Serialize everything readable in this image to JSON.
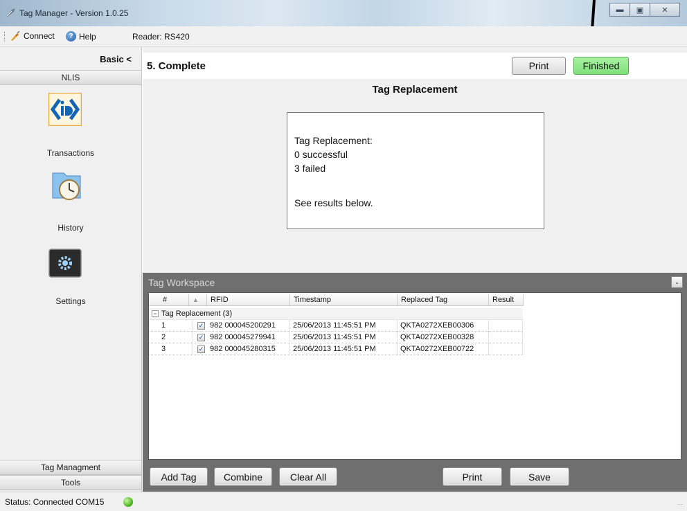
{
  "window": {
    "title": "Tag Manager - Version 1.0.25"
  },
  "menu": {
    "connect": "Connect",
    "help": "Help",
    "reader": "Reader: RS420"
  },
  "sidebar": {
    "mode_toggle": "Basic <",
    "section_top": "NLIS",
    "tiles": [
      {
        "label": "Transactions",
        "icon": "id-logo-icon"
      },
      {
        "label": "History",
        "icon": "clock-folder-icon"
      },
      {
        "label": "Settings",
        "icon": "gear-icon"
      }
    ],
    "section_tag_management": "Tag Managment",
    "section_tools": "Tools"
  },
  "step": {
    "title": "5. Complete",
    "print_label": "Print",
    "finished_label": "Finished"
  },
  "result": {
    "heading": "Tag Replacement",
    "lines": [
      "Tag Replacement:",
      "0 successful",
      "3 failed"
    ],
    "footer": "See results below."
  },
  "workspace": {
    "title": "Tag Workspace",
    "collapse_label": "-",
    "columns": [
      "#",
      "▲",
      "RFID",
      "Timestamp",
      "Replaced Tag",
      "Result"
    ],
    "group_label": "Tag Replacement (3)",
    "rows": [
      {
        "num": "1",
        "rfid": "982 000045200291",
        "timestamp": "25/06/2013 11:45:51 PM",
        "replaced": "QKTA0272XEB00306",
        "result": ""
      },
      {
        "num": "2",
        "rfid": "982 000045279941",
        "timestamp": "25/06/2013 11:45:51 PM",
        "replaced": "QKTA0272XEB00328",
        "result": ""
      },
      {
        "num": "3",
        "rfid": "982 000045280315",
        "timestamp": "25/06/2013 11:45:51 PM",
        "replaced": "QKTA0272XEB00722",
        "result": ""
      }
    ],
    "buttons": {
      "add_tag": "Add Tag",
      "combine": "Combine",
      "clear_all": "Clear All",
      "print": "Print",
      "save": "Save"
    }
  },
  "status": {
    "text": "Status: Connected COM15",
    "color": "#4bb51b"
  },
  "colors": {
    "finished_button": "#8ee889",
    "workspace_bg": "#6f6f6f"
  }
}
